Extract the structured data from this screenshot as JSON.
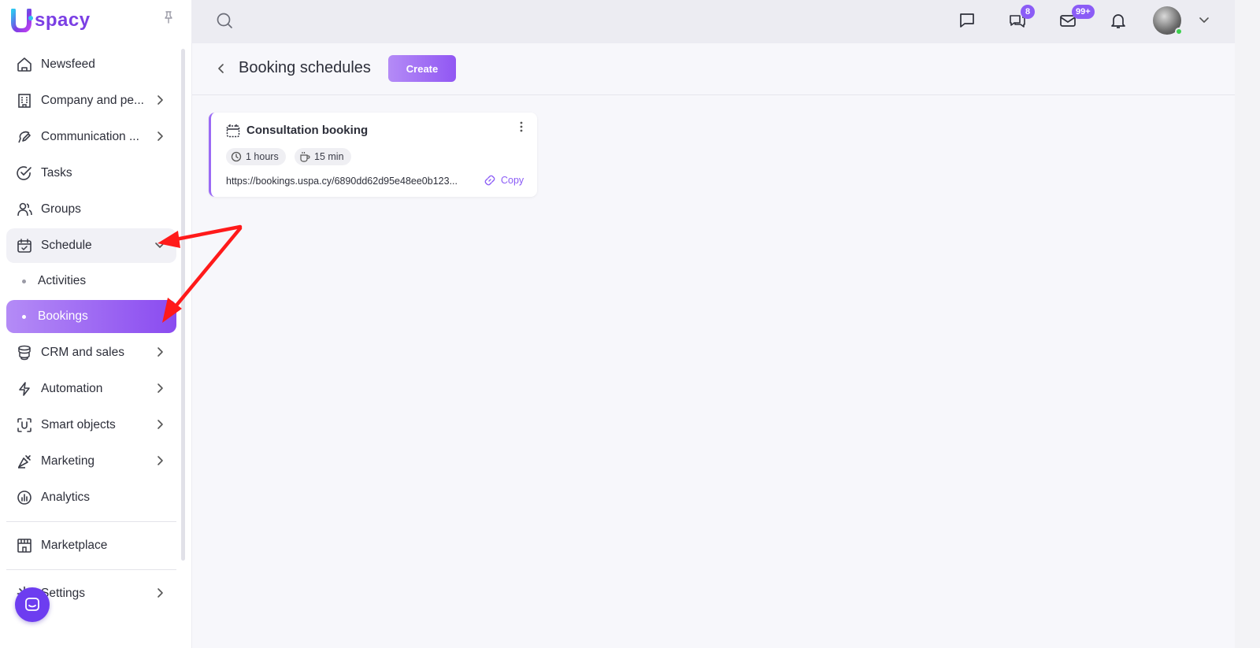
{
  "brand": {
    "logo_letter": "U",
    "logo_text": "spacy",
    "accent": "#8b5cf6"
  },
  "sidebar": {
    "items": [
      {
        "label": "Newsfeed",
        "icon": "home-icon"
      },
      {
        "label": "Company and pe...",
        "icon": "building-icon"
      },
      {
        "label": "Communication ...",
        "icon": "communication-icon"
      },
      {
        "label": "Tasks",
        "icon": "check-circle-icon"
      },
      {
        "label": "Groups",
        "icon": "users-icon"
      },
      {
        "label": "Schedule",
        "icon": "calendar-check-icon"
      },
      {
        "label": "CRM and sales",
        "icon": "database-icon"
      },
      {
        "label": "Automation",
        "icon": "lightning-icon"
      },
      {
        "label": "Smart objects",
        "icon": "scan-icon"
      },
      {
        "label": "Marketing",
        "icon": "megaphone-icon"
      },
      {
        "label": "Analytics",
        "icon": "chart-icon"
      },
      {
        "label": "Marketplace",
        "icon": "store-icon"
      },
      {
        "label": "Settings",
        "icon": "gear-icon"
      }
    ],
    "schedule_sub": [
      {
        "label": "Activities"
      },
      {
        "label": "Bookings"
      }
    ]
  },
  "topbar": {
    "chats_badge": "8",
    "mail_badge": "99+"
  },
  "page": {
    "title": "Booking schedules",
    "create_label": "Create"
  },
  "card": {
    "title": "Consultation booking",
    "duration": "1 hours",
    "break": "15 min",
    "link": "https://bookings.uspa.cy/6890dd62d95e48ee0b123...",
    "copy_label": "Copy"
  }
}
